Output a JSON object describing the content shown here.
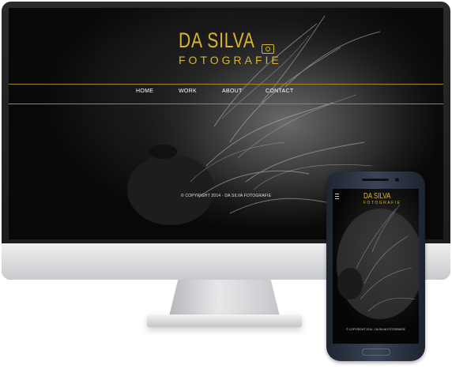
{
  "logo": {
    "title": "DA SILVA",
    "subtitle": "FOTOGRAFIE"
  },
  "nav": {
    "items": [
      {
        "label": "HOME"
      },
      {
        "label": "WORK"
      },
      {
        "label": "ABOUT"
      },
      {
        "label": "CONTACT"
      }
    ]
  },
  "footer": {
    "copyright": "© COPYRIGHT 2014 - DA SILVA FOTOGRAFIE"
  },
  "mobile": {
    "logo_title": "DA SILVA",
    "logo_subtitle": "FOTOGRAFIE",
    "copyright": "© COPYRIGHT 2014 - DA SILVA FOTOGRAFIE"
  },
  "colors": {
    "accent": "#d9b62b",
    "background": "#0b0b0b",
    "nav_text": "#ffffff"
  },
  "icons": [
    "camera-icon",
    "hamburger-menu-icon"
  ]
}
